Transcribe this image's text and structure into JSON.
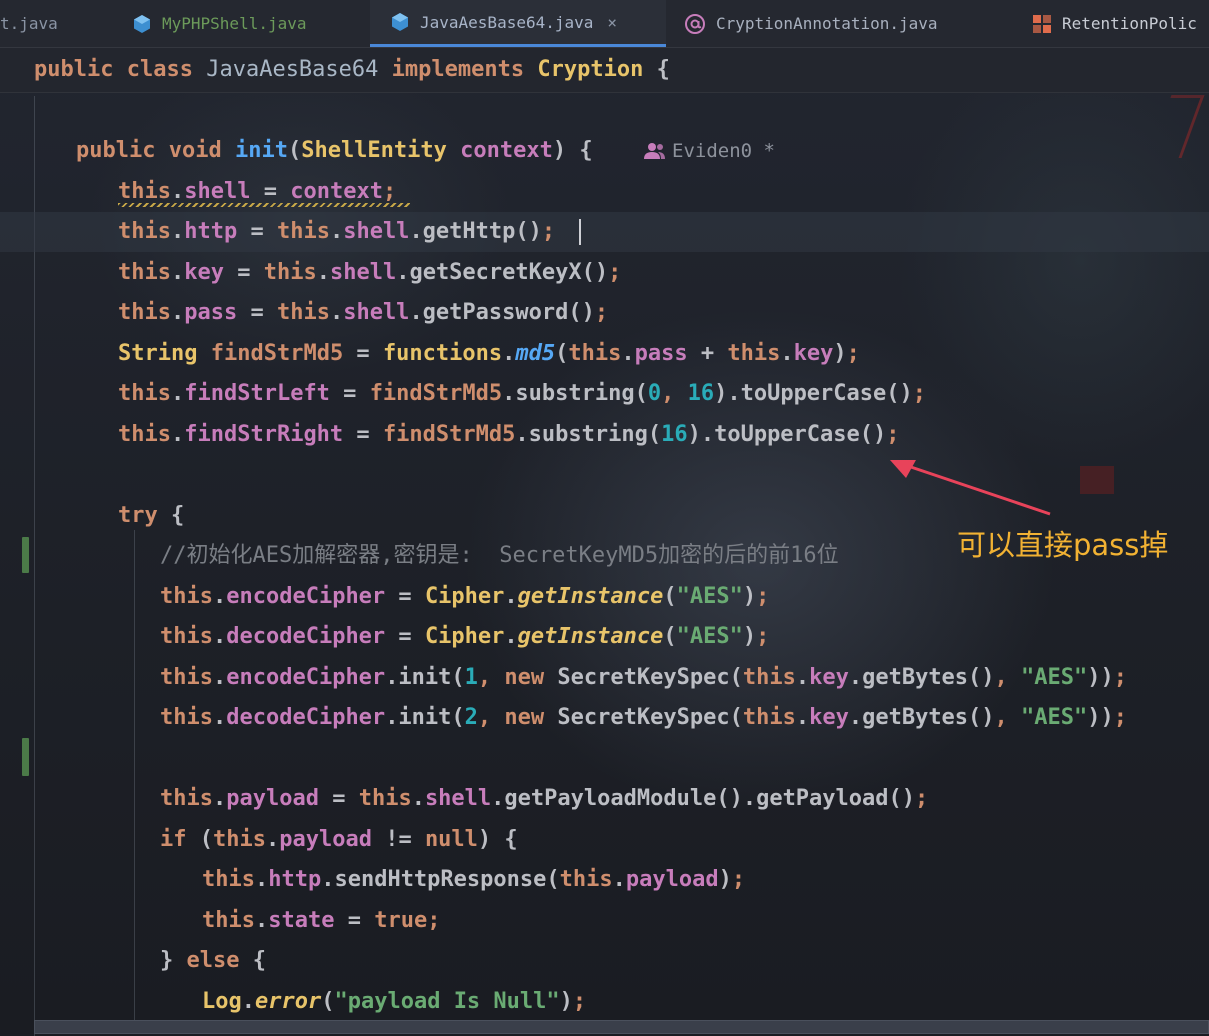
{
  "tabs": [
    {
      "label": "t.java",
      "icon": "java-file-icon"
    },
    {
      "label": "MyPHPShell.java",
      "icon": "java-class-icon"
    },
    {
      "label": "JavaAesBase64.java",
      "icon": "java-class-icon",
      "active": true
    },
    {
      "label": "CryptionAnnotation.java",
      "icon": "annotation-icon"
    },
    {
      "label": "RetentionPolic",
      "icon": "enum-icon"
    }
  ],
  "tab_close_symbol": "×",
  "class_header": {
    "kw1": "public",
    "kw2": "class",
    "name": "JavaAesBase64",
    "kw3": "implements",
    "iface": "Cryption",
    "brace": "{"
  },
  "author": {
    "name": "Eviden0",
    "suffix": "*"
  },
  "code": {
    "method_sig": {
      "kw1": "public",
      "kw2": "void",
      "name": "init",
      "paren": "(",
      "type": "ShellEntity",
      "param": "context",
      "close": ") {"
    },
    "comment": "//初始化AES加解密器,密钥是:  SecretKeyMD5加密的后的前16位",
    "log_string": "\"payload Is Null\""
  },
  "annotation_text": "可以直接pass掉",
  "colors": {
    "keyword": "#cf8e6d",
    "field": "#c77dbb",
    "method": "#56a8f5",
    "class": "#e8c46a",
    "string": "#6aab73",
    "number": "#2aacb8",
    "annotation": "#f2b233",
    "arrow": "#e8435a"
  }
}
